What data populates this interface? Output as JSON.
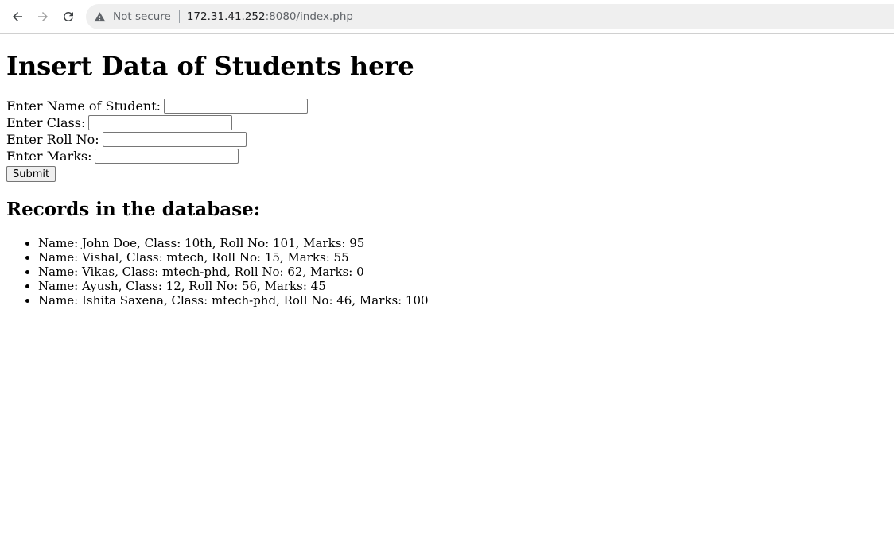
{
  "browser": {
    "security_label": "Not secure",
    "url_host": "172.31.41.252",
    "url_rest": ":8080/index.php"
  },
  "page": {
    "heading": "Insert Data of Students here",
    "form": {
      "name_label": "Enter Name of Student:",
      "name_value": "",
      "class_label": "Enter Class:",
      "class_value": "",
      "roll_label": "Enter Roll No:",
      "roll_value": "",
      "marks_label": "Enter Marks:",
      "marks_value": "",
      "submit_label": "Submit"
    },
    "records_heading": "Records in the database:",
    "records": [
      "Name: John Doe, Class: 10th, Roll No: 101, Marks: 95",
      "Name: Vishal, Class: mtech, Roll No: 15, Marks: 55",
      "Name: Vikas, Class: mtech-phd, Roll No: 62, Marks: 0",
      "Name: Ayush, Class: 12, Roll No: 56, Marks: 45",
      "Name: Ishita Saxena, Class: mtech-phd, Roll No: 46, Marks: 100"
    ]
  }
}
